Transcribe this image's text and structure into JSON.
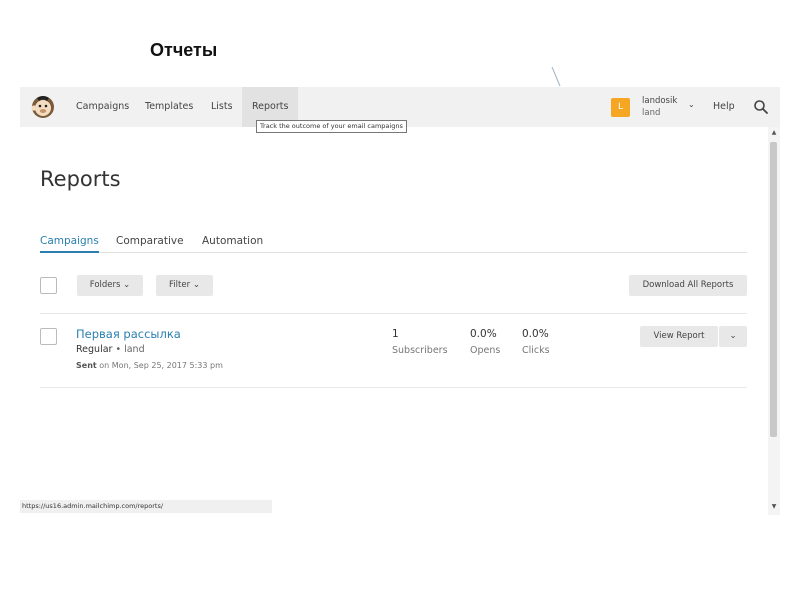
{
  "slide": {
    "title": "Отчеты"
  },
  "nav": {
    "items": [
      "Campaigns",
      "Templates",
      "Lists",
      "Reports"
    ],
    "tooltip": "Track the outcome of your email campaigns",
    "user": {
      "initial": "L",
      "name": "landosik",
      "org": "land"
    },
    "help": "Help"
  },
  "page": {
    "title": "Reports",
    "tabs": [
      "Campaigns",
      "Comparative",
      "Automation"
    ],
    "toolbar": {
      "folders": "Folders",
      "filter": "Filter",
      "download": "Download All Reports"
    }
  },
  "campaigns": [
    {
      "name": "Первая рассылка",
      "type": "Regular",
      "list": "land",
      "sent_label": "Sent",
      "sent_date": "on Mon, Sep 25, 2017 5:33 pm",
      "subscribers": "1",
      "subscribers_label": "Subscribers",
      "opens": "0.0%",
      "opens_label": "Opens",
      "clicks": "0.0%",
      "clicks_label": "Clicks",
      "action": "View Report"
    }
  ],
  "status_url": "https://us16.admin.mailchimp.com/reports/",
  "colors": {
    "accent": "#2a7fb0",
    "avatar": "#f5a623",
    "nav_bg": "#f1f1f1"
  },
  "icons": [
    "mailchimp-logo",
    "chevron-down-icon",
    "search-icon"
  ]
}
